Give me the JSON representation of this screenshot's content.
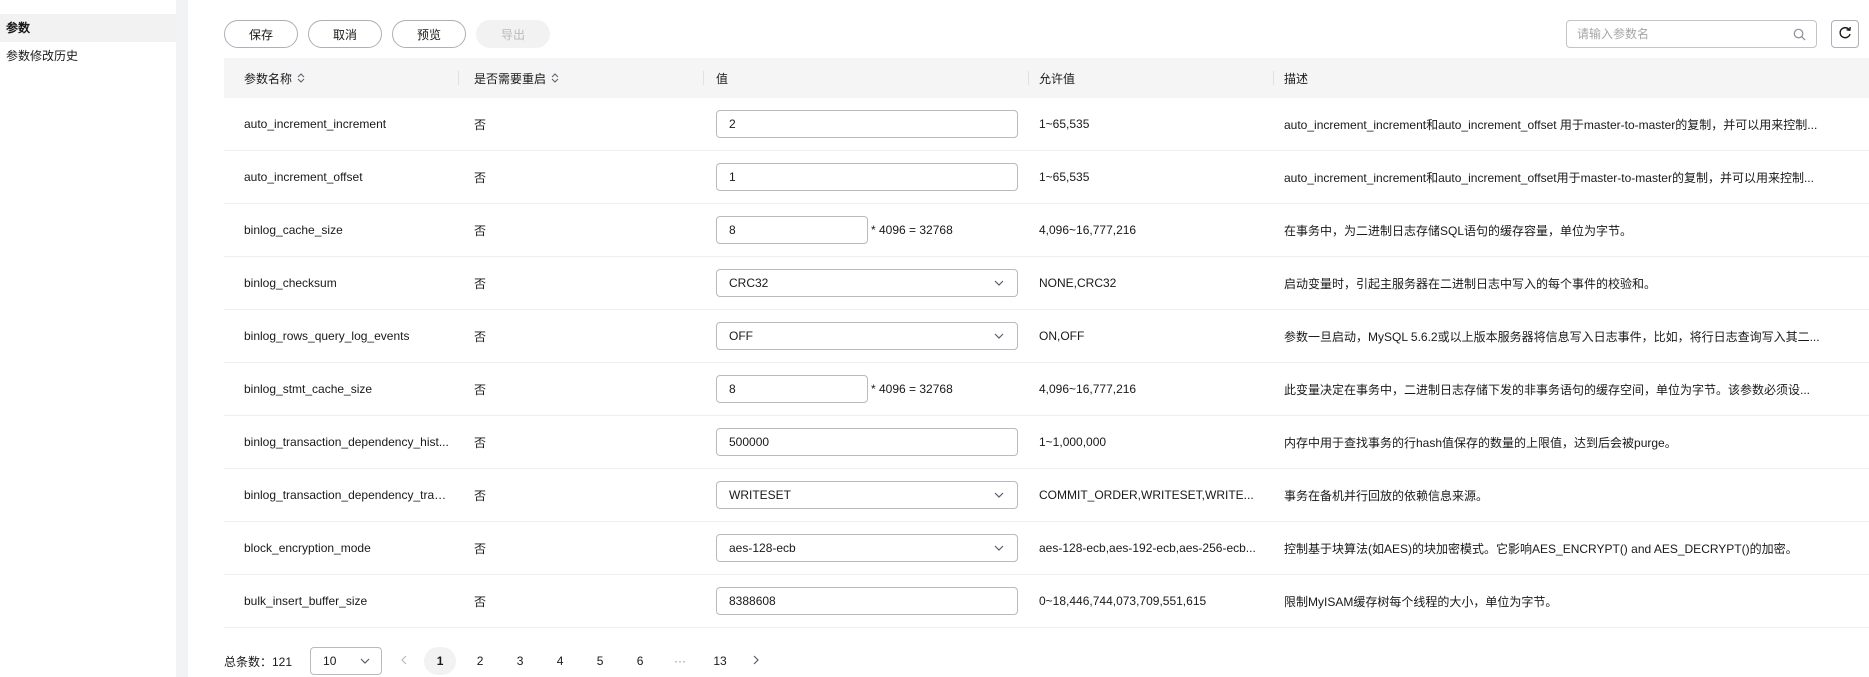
{
  "sidebar": {
    "items": [
      {
        "label": "参数",
        "active": true
      },
      {
        "label": "参数修改历史",
        "active": false
      }
    ]
  },
  "toolbar": {
    "save_label": "保存",
    "cancel_label": "取消",
    "preview_label": "预览",
    "export_label": "导出"
  },
  "search": {
    "placeholder": "请输入参数名",
    "value": ""
  },
  "table": {
    "headers": {
      "name": "参数名称",
      "restart": "是否需要重启",
      "value": "值",
      "allowed": "允许值",
      "desc": "描述"
    },
    "rows": [
      {
        "name": "auto_increment_increment",
        "restart": "否",
        "value": "2",
        "allowed": "1~65,535",
        "desc": "auto_increment_increment和auto_increment_offset 用于master-to-master的复制，并可以用来控制..."
      },
      {
        "name": "auto_increment_offset",
        "restart": "否",
        "value": "1",
        "allowed": "1~65,535",
        "desc": "auto_increment_increment和auto_increment_offset用于master-to-master的复制，并可以用来控制..."
      },
      {
        "name": "binlog_cache_size",
        "restart": "否",
        "value": "8",
        "calc": "* 4096 = 32768",
        "allowed": "4,096~16,777,216",
        "desc": "在事务中，为二进制日志存储SQL语句的缓存容量，单位为字节。"
      },
      {
        "name": "binlog_checksum",
        "restart": "否",
        "value": "CRC32",
        "allowed": "NONE,CRC32",
        "desc": "启动变量时，引起主服务器在二进制日志中写入的每个事件的校验和。"
      },
      {
        "name": "binlog_rows_query_log_events",
        "restart": "否",
        "value": "OFF",
        "allowed": "ON,OFF",
        "desc": "参数一旦启动，MySQL 5.6.2或以上版本服务器将信息写入日志事件，比如，将行日志查询写入其二..."
      },
      {
        "name": "binlog_stmt_cache_size",
        "restart": "否",
        "value": "8",
        "calc": "* 4096 = 32768",
        "allowed": "4,096~16,777,216",
        "desc": "此变量决定在事务中，二进制日志存储下发的非事务语句的缓存空间，单位为字节。该参数必须设..."
      },
      {
        "name": "binlog_transaction_dependency_hist...",
        "restart": "否",
        "value": "500000",
        "allowed": "1~1,000,000",
        "desc": "内存中用于查找事务的行hash值保存的数量的上限值，达到后会被purge。"
      },
      {
        "name": "binlog_transaction_dependency_trac...",
        "restart": "否",
        "value": "WRITESET",
        "allowed": "COMMIT_ORDER,WRITESET,WRITE...",
        "desc": "事务在备机并行回放的依赖信息来源。"
      },
      {
        "name": "block_encryption_mode",
        "restart": "否",
        "value": "aes-128-ecb",
        "allowed": "aes-128-ecb,aes-192-ecb,aes-256-ecb...",
        "desc": "控制基于块算法(如AES)的块加密模式。它影响AES_ENCRYPT() and AES_DECRYPT()的加密。"
      },
      {
        "name": "bulk_insert_buffer_size",
        "restart": "否",
        "value": "8388608",
        "allowed": "0~18,446,744,073,709,551,615",
        "desc": "限制MyISAM缓存树每个线程的大小，单位为字节。"
      }
    ]
  },
  "pagination": {
    "total": "总条数：121",
    "page_size": "10",
    "pages": [
      "1",
      "2",
      "3",
      "4",
      "5",
      "6",
      "···",
      "13"
    ],
    "current": "1"
  },
  "icons": {
    "search": "search-icon",
    "refresh": "refresh-icon",
    "sort": "sort-icon",
    "chevron": "chevron-down-icon",
    "prev": "chevron-left-icon",
    "next": "chevron-right-icon"
  }
}
